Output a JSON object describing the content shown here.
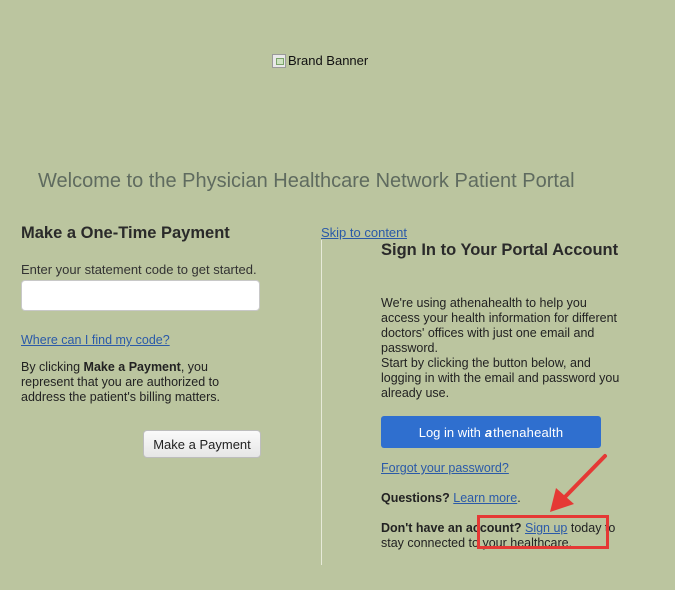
{
  "banner": {
    "alt_text": "Brand Banner"
  },
  "welcome_title": "Welcome to the Physician Healthcare Network Patient Portal",
  "payment": {
    "title": "Make a One-Time Payment",
    "hint": "Enter your statement code to get started.",
    "code_value": "",
    "where_link": "Where can I find my code?",
    "consent_prefix": "By clicking ",
    "consent_bold": "Make a Payment",
    "consent_suffix": ", you represent that you are authorized to address the patient's billing matters.",
    "button_label": "Make a Payment"
  },
  "skip_link": "Skip to content",
  "signin": {
    "title": "Sign In to Your Portal Account",
    "para1": "We're using athenahealth to help you access your health information for different doctors' offices with just one email and password.",
    "para2": "Start by clicking the button below, and logging in with the email and password you already use.",
    "login_button_prefix": "Log in with",
    "login_button_brand_mark": "a",
    "login_button_brand_text": "thenahealth",
    "forgot_link": "Forgot your password?",
    "questions_label": "Questions?",
    "learn_more_link": "Learn more",
    "learn_more_suffix": ".",
    "no_account_label": "Don't have an account?",
    "signup_link": "Sign up",
    "signup_suffix": " today to stay connected to your healthcare."
  },
  "colors": {
    "background": "#bbc59f",
    "link": "#2b5aa8",
    "login_button": "#2f6fcf",
    "annotation": "#e53935"
  },
  "icons": [
    "broken-image-icon",
    "annotation-arrow-icon"
  ]
}
